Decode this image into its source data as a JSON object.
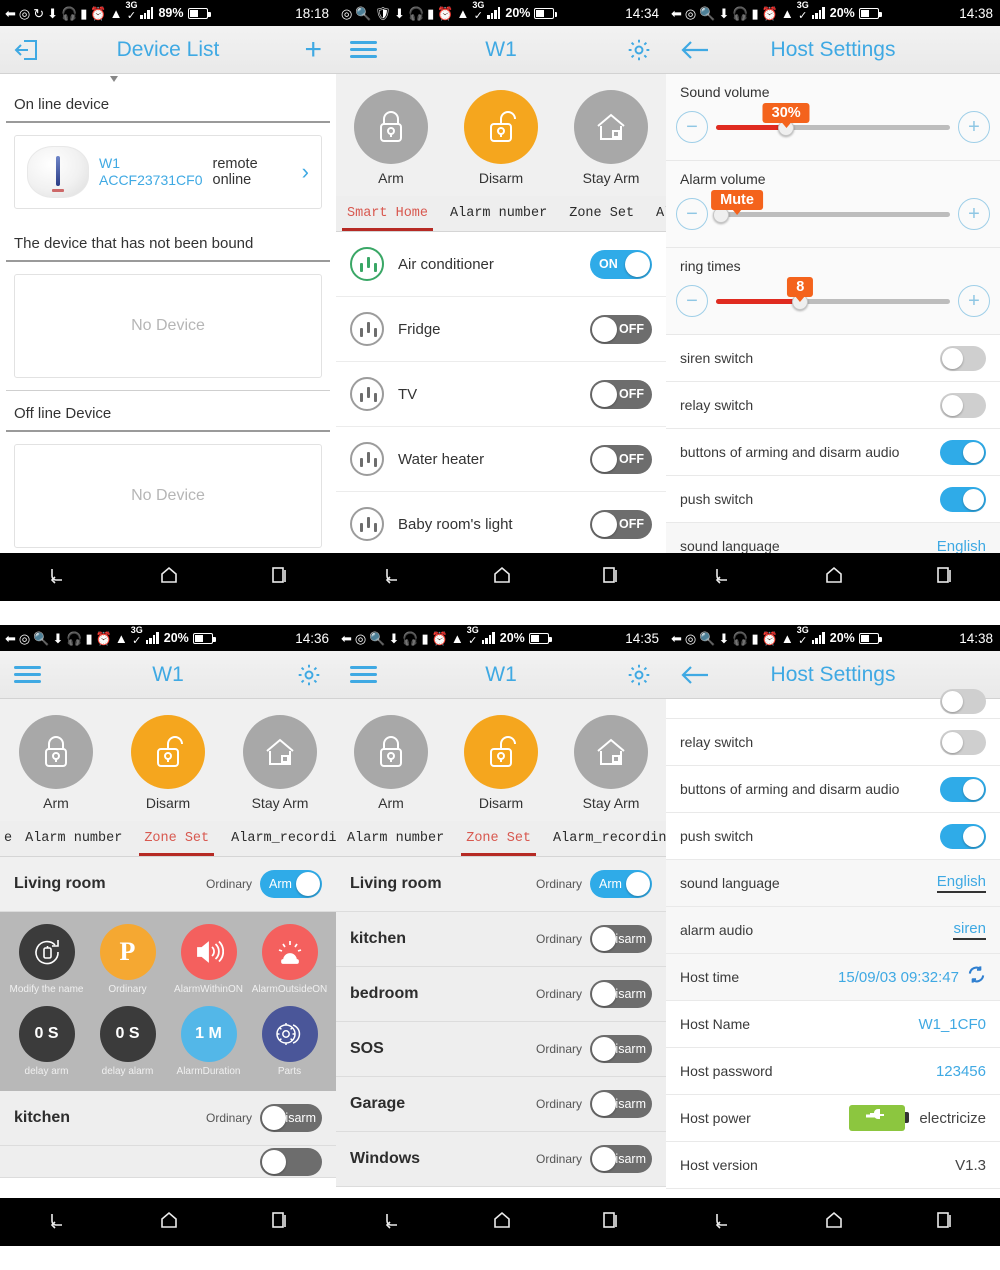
{
  "colors": {
    "accent_blue": "#3fa9e3",
    "toggle_on": "#2fabe8",
    "toggle_off": "#6d6d6d",
    "orange": "#f5a61e",
    "bubble_orange": "#f4631c",
    "tab_selected_red": "#d8584f",
    "green_battery": "#8cc63f"
  },
  "panels": {
    "device_list": {
      "status": {
        "battery": "89%",
        "network": "3G",
        "time": "18:18"
      },
      "appbar": {
        "back_icon": "exit-icon",
        "title": "Device List",
        "add_icon": "plus-icon"
      },
      "sections": [
        {
          "heading": "On line device"
        },
        {
          "heading": "The device that has not been bound"
        },
        {
          "heading": "Off line Device"
        }
      ],
      "device": {
        "name": "W1",
        "mac": "ACCF23731CF0",
        "status": "remote online"
      },
      "empty_label": "No Device"
    },
    "smart_home": {
      "status": {
        "battery": "20%",
        "network": "3G",
        "time": "14:34"
      },
      "appbar": {
        "menu_icon": "hamburger-icon",
        "title": "W1",
        "settings_icon": "gear-icon"
      },
      "arm_buttons": [
        {
          "label": "Arm",
          "icon": "lock-closed-icon",
          "active": false
        },
        {
          "label": "Disarm",
          "icon": "lock-open-icon",
          "active": true
        },
        {
          "label": "Stay Arm",
          "icon": "house-icon",
          "active": false
        }
      ],
      "tabs": [
        {
          "label": "Smart Home",
          "selected": true
        },
        {
          "label": "Alarm number",
          "selected": false
        },
        {
          "label": "Zone Set",
          "selected": false
        },
        {
          "label": "Alar",
          "selected": false
        }
      ],
      "devices": [
        {
          "name": "Air conditioner",
          "state": "ON",
          "on": true
        },
        {
          "name": "Fridge",
          "state": "OFF",
          "on": false
        },
        {
          "name": "TV",
          "state": "OFF",
          "on": false
        },
        {
          "name": "Water heater",
          "state": "OFF",
          "on": false
        },
        {
          "name": "Baby room's light",
          "state": "OFF",
          "on": false
        }
      ]
    },
    "host_settings_top": {
      "status": {
        "battery": "20%",
        "network": "3G",
        "time": "14:38"
      },
      "appbar": {
        "back_icon": "arrow-left-icon",
        "title": "Host Settings"
      },
      "sliders": [
        {
          "label": "Sound volume",
          "value": "30%",
          "percent": 30,
          "filled": true
        },
        {
          "label": "Alarm volume",
          "value": "Mute",
          "percent": 0,
          "filled": false
        },
        {
          "label": "ring times",
          "value": "8",
          "percent": 35,
          "filled": true
        }
      ],
      "switches": [
        {
          "label": "siren switch",
          "on": false
        },
        {
          "label": "relay switch",
          "on": false
        },
        {
          "label": "buttons of arming and disarm audio",
          "on": true
        },
        {
          "label": "push switch",
          "on": true
        }
      ],
      "sound_language": {
        "label": "sound language",
        "value": "English"
      }
    },
    "zone_expanded": {
      "status": {
        "battery": "20%",
        "network": "3G",
        "time": "14:36"
      },
      "appbar": {
        "menu_icon": "hamburger-icon",
        "title": "W1",
        "settings_icon": "gear-icon"
      },
      "arm_buttons": [
        {
          "label": "Arm",
          "icon": "lock-closed-icon",
          "active": false
        },
        {
          "label": "Disarm",
          "icon": "lock-open-icon",
          "active": true
        },
        {
          "label": "Stay Arm",
          "icon": "house-icon",
          "active": false
        }
      ],
      "tabs": [
        {
          "label": "e",
          "selected": false
        },
        {
          "label": "Alarm number",
          "selected": false
        },
        {
          "label": "Zone Set",
          "selected": true
        },
        {
          "label": "Alarm_recordin",
          "selected": false
        }
      ],
      "zone": {
        "name": "Living room",
        "type": "Ordinary",
        "state": "Arm",
        "on": true
      },
      "options": [
        {
          "label": "Modify the name",
          "badge": "",
          "icon": "edit-name-icon",
          "color": "#3b3b3b"
        },
        {
          "label": "Ordinary",
          "badge": "P",
          "icon": "ordinary-icon",
          "color": "#f5a832"
        },
        {
          "label": "AlarmWithinON",
          "badge": "",
          "icon": "speaker-icon",
          "color": "#f4605e"
        },
        {
          "label": "AlarmOutsideON",
          "badge": "",
          "icon": "siren-icon",
          "color": "#f4605e"
        },
        {
          "label": "delay arm",
          "badge": "0 S",
          "icon": "delay-arm-icon",
          "color": "#3b3b3b"
        },
        {
          "label": "delay alarm",
          "badge": "0 S",
          "icon": "delay-alarm-icon",
          "color": "#3b3b3b"
        },
        {
          "label": "AlarmDuration",
          "badge": "1 M",
          "icon": "duration-icon",
          "color": "#53b7e8"
        },
        {
          "label": "Parts",
          "badge": "",
          "icon": "parts-gear-icon",
          "color": "#4a5699"
        }
      ],
      "next_zone": {
        "name": "kitchen",
        "type": "Ordinary",
        "state": "Disarm",
        "on": false
      }
    },
    "zone_list": {
      "status": {
        "battery": "20%",
        "network": "3G",
        "time": "14:35"
      },
      "appbar": {
        "menu_icon": "hamburger-icon",
        "title": "W1",
        "settings_icon": "gear-icon"
      },
      "arm_buttons": [
        {
          "label": "Arm",
          "icon": "lock-closed-icon",
          "active": false
        },
        {
          "label": "Disarm",
          "icon": "lock-open-icon",
          "active": true
        },
        {
          "label": "Stay Arm",
          "icon": "house-icon",
          "active": false
        }
      ],
      "tabs": [
        {
          "label": "Alarm number",
          "selected": false
        },
        {
          "label": "Zone Set",
          "selected": true
        },
        {
          "label": "Alarm_recordin",
          "selected": false
        }
      ],
      "zones": [
        {
          "name": "Living room",
          "type": "Ordinary",
          "state": "Arm",
          "on": true
        },
        {
          "name": "kitchen",
          "type": "Ordinary",
          "state": "Disarm",
          "on": false
        },
        {
          "name": "bedroom",
          "type": "Ordinary",
          "state": "Disarm",
          "on": false
        },
        {
          "name": "SOS",
          "type": "Ordinary",
          "state": "Disarm",
          "on": false
        },
        {
          "name": "Garage",
          "type": "Ordinary",
          "state": "Disarm",
          "on": false
        },
        {
          "name": "Windows",
          "type": "Ordinary",
          "state": "Disarm",
          "on": false
        }
      ]
    },
    "host_settings_bottom": {
      "status": {
        "battery": "20%",
        "network": "3G",
        "time": "14:38"
      },
      "appbar": {
        "back_icon": "arrow-left-icon",
        "title": "Host Settings"
      },
      "switches": [
        {
          "label": "relay switch",
          "on": false
        },
        {
          "label": "buttons of arming and disarm audio",
          "on": true
        },
        {
          "label": "push switch",
          "on": true
        }
      ],
      "rows": [
        {
          "label": "sound language",
          "value": "English",
          "style": "link"
        },
        {
          "label": "alarm audio",
          "value": "siren",
          "style": "link-underline"
        },
        {
          "label": "Host time",
          "value": "15/09/03  09:32:47",
          "style": "time"
        },
        {
          "label": "Host Name",
          "value": "W1_1CF0",
          "style": "link"
        },
        {
          "label": "Host password",
          "value": "123456",
          "style": "link"
        },
        {
          "label": "Host power",
          "value": "electricize",
          "style": "battery"
        },
        {
          "label": "Host version",
          "value": "V1.3",
          "style": "plain"
        }
      ]
    }
  },
  "navbar": {
    "back": "back-icon",
    "home": "home-icon",
    "recents": "recents-icon"
  }
}
